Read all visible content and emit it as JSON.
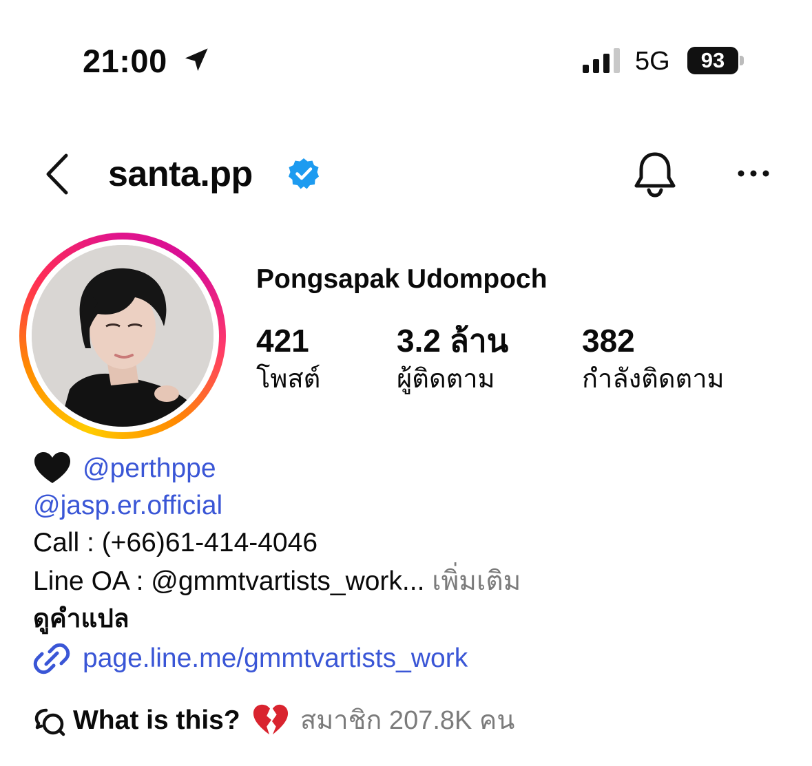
{
  "status_bar": {
    "time": "21:00",
    "network": "5G",
    "battery": "93",
    "icons": [
      "location-arrow-icon",
      "signal-bars-icon",
      "battery-icon"
    ]
  },
  "header": {
    "username": "santa.pp",
    "icons": [
      "back-chevron-icon",
      "verified-badge-icon",
      "bell-icon",
      "more-icon"
    ],
    "accent_color": "#1d9bf0"
  },
  "profile": {
    "full_name": "Pongsapak Udompoch",
    "stats": [
      {
        "value": "421",
        "label": "โพสต์"
      },
      {
        "value": "3.2 ล้าน",
        "label": "ผู้ติดตาม"
      },
      {
        "value": "382",
        "label": "กำลังติดตาม"
      }
    ]
  },
  "bio": {
    "mention_1": "@perthppe",
    "mention_2": "@jasp.er.official",
    "call": "Call : (+66)61-414-4046",
    "line_oa": "Line OA : @gmmtvartists_work...",
    "more": "เพิ่มเติม",
    "translate": "ดูคำแปล",
    "link": "page.line.me/gmmtvartists_work",
    "link_color": "#3a56d6"
  },
  "channel": {
    "title": "What is this?",
    "members": "สมาชิก 207.8K คน"
  }
}
